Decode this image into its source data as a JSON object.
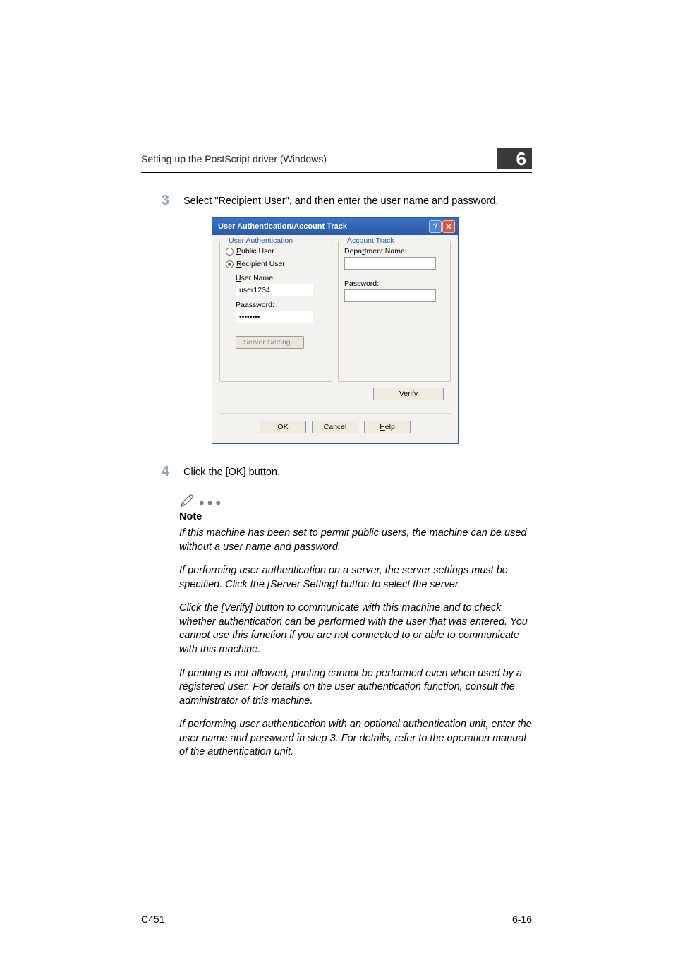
{
  "header": {
    "title": "Setting up the PostScript driver (Windows)",
    "chapter": "6"
  },
  "steps": {
    "s3": {
      "num": "3",
      "text": "Select \"Recipient User\", and then enter the user name and password."
    },
    "s4": {
      "num": "4",
      "text": "Click the [OK] button."
    }
  },
  "dialog": {
    "title": "User Authentication/Account Track",
    "userauth": {
      "legend": "User Authentication",
      "public_prefix": "P",
      "public_rest": "ublic User",
      "recipient_prefix": "R",
      "recipient_rest": "ecipient User",
      "username_u": "U",
      "username_rest": "ser Name:",
      "username_value": "user1234",
      "password_label": "P",
      "password_rest": "assword:",
      "password_value": "••••••••",
      "server_btn": "Server Setting..."
    },
    "acct": {
      "legend": "Account Track",
      "dept_prefix": "Depa",
      "dept_u": "r",
      "dept_rest": "tment Name:",
      "pass_prefix": "Pass",
      "pass_u": "w",
      "pass_rest": "ord:"
    },
    "verify_u": "V",
    "verify_rest": "erify",
    "ok": "OK",
    "cancel": "Cancel",
    "help_u": "H",
    "help_rest": "elp"
  },
  "note": {
    "heading": "Note",
    "p1": "If this machine has been set to permit public users, the machine can be used without a user name and password.",
    "p2": "If performing user authentication on a server, the server settings must be specified. Click the [Server Setting] button to select the server.",
    "p3": "Click the [Verify] button to communicate with this machine and to check whether authentication can be performed with the user that was entered. You cannot use this function if you are not connected to or able to communicate with this machine.",
    "p4": "If printing is not allowed, printing cannot be performed even when used by a registered user. For details on the user authentication function, consult the administrator of this machine.",
    "p5": "If performing user authentication with an optional authentication unit, enter the user name and password in step 3. For details, refer to the operation manual of the authentication unit."
  },
  "footer": {
    "left": "C451",
    "right": "6-16"
  }
}
